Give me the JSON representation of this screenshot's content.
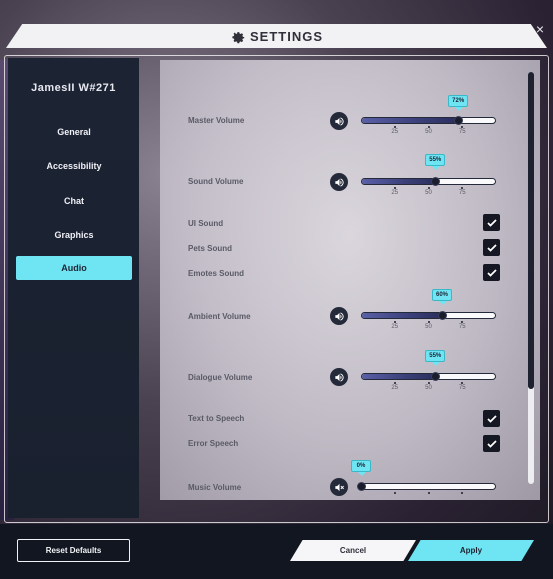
{
  "header": {
    "title": "SETTINGS",
    "close_label": "×",
    "icon": "gear-icon"
  },
  "sidebar": {
    "username": "JamesII W#271",
    "items": [
      {
        "label": "General",
        "active": false
      },
      {
        "label": "Accessibility",
        "active": false
      },
      {
        "label": "Chat",
        "active": false
      },
      {
        "label": "Graphics",
        "active": false
      },
      {
        "label": "Audio",
        "active": true
      }
    ]
  },
  "settings": {
    "master_volume": {
      "label": "Master Volume",
      "value": 72,
      "value_label": "72%"
    },
    "sound_volume": {
      "label": "Sound Volume",
      "value": 55,
      "value_label": "55%"
    },
    "ui_sound": {
      "label": "UI Sound",
      "checked": true
    },
    "pets_sound": {
      "label": "Pets Sound",
      "checked": true
    },
    "emotes_sound": {
      "label": "Emotes Sound",
      "checked": true
    },
    "ambient_volume": {
      "label": "Ambient Volume",
      "value": 60,
      "value_label": "60%"
    },
    "dialogue_volume": {
      "label": "Dialogue Volume",
      "value": 55,
      "value_label": "55%"
    },
    "text_to_speech": {
      "label": "Text to Speech",
      "checked": true
    },
    "error_speech": {
      "label": "Error Speech",
      "checked": true
    },
    "music_volume": {
      "label": "Music Volume",
      "value": 0,
      "value_label": "0%",
      "muted": true
    }
  },
  "ticks": {
    "t25": "25",
    "t50": "50",
    "t75": "75"
  },
  "scroll": {
    "position_fraction": 0.0,
    "visible_fraction": 0.77
  },
  "footer": {
    "reset_label": "Reset Defaults",
    "cancel_label": "Cancel",
    "apply_label": "Apply"
  },
  "colors": {
    "accent": "#6fe4f2",
    "sidebar": "#1c2434",
    "footer": "#121620"
  }
}
